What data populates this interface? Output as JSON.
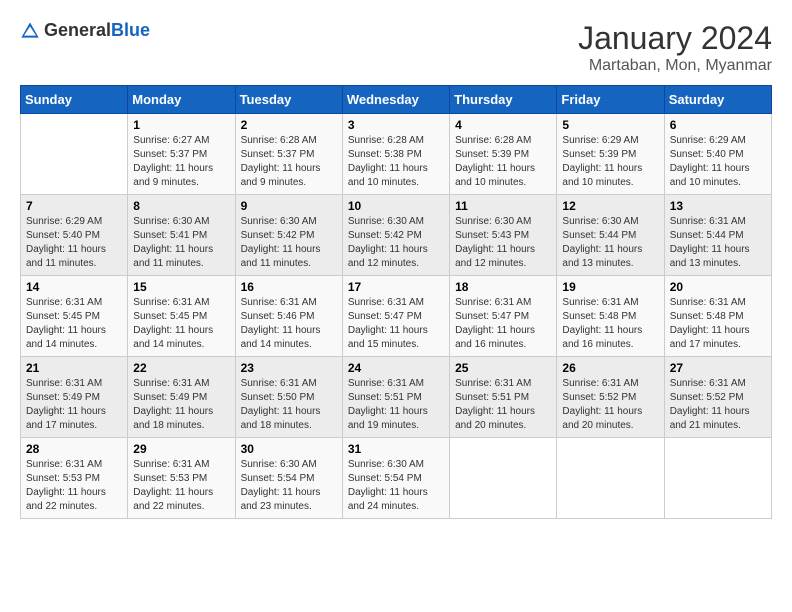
{
  "header": {
    "logo_general": "General",
    "logo_blue": "Blue",
    "title": "January 2024",
    "subtitle": "Martaban, Mon, Myanmar"
  },
  "weekdays": [
    "Sunday",
    "Monday",
    "Tuesday",
    "Wednesday",
    "Thursday",
    "Friday",
    "Saturday"
  ],
  "weeks": [
    [
      {
        "day": "",
        "info": ""
      },
      {
        "day": "1",
        "info": "Sunrise: 6:27 AM\nSunset: 5:37 PM\nDaylight: 11 hours\nand 9 minutes."
      },
      {
        "day": "2",
        "info": "Sunrise: 6:28 AM\nSunset: 5:37 PM\nDaylight: 11 hours\nand 9 minutes."
      },
      {
        "day": "3",
        "info": "Sunrise: 6:28 AM\nSunset: 5:38 PM\nDaylight: 11 hours\nand 10 minutes."
      },
      {
        "day": "4",
        "info": "Sunrise: 6:28 AM\nSunset: 5:39 PM\nDaylight: 11 hours\nand 10 minutes."
      },
      {
        "day": "5",
        "info": "Sunrise: 6:29 AM\nSunset: 5:39 PM\nDaylight: 11 hours\nand 10 minutes."
      },
      {
        "day": "6",
        "info": "Sunrise: 6:29 AM\nSunset: 5:40 PM\nDaylight: 11 hours\nand 10 minutes."
      }
    ],
    [
      {
        "day": "7",
        "info": "Sunrise: 6:29 AM\nSunset: 5:40 PM\nDaylight: 11 hours\nand 11 minutes."
      },
      {
        "day": "8",
        "info": "Sunrise: 6:30 AM\nSunset: 5:41 PM\nDaylight: 11 hours\nand 11 minutes."
      },
      {
        "day": "9",
        "info": "Sunrise: 6:30 AM\nSunset: 5:42 PM\nDaylight: 11 hours\nand 11 minutes."
      },
      {
        "day": "10",
        "info": "Sunrise: 6:30 AM\nSunset: 5:42 PM\nDaylight: 11 hours\nand 12 minutes."
      },
      {
        "day": "11",
        "info": "Sunrise: 6:30 AM\nSunset: 5:43 PM\nDaylight: 11 hours\nand 12 minutes."
      },
      {
        "day": "12",
        "info": "Sunrise: 6:30 AM\nSunset: 5:44 PM\nDaylight: 11 hours\nand 13 minutes."
      },
      {
        "day": "13",
        "info": "Sunrise: 6:31 AM\nSunset: 5:44 PM\nDaylight: 11 hours\nand 13 minutes."
      }
    ],
    [
      {
        "day": "14",
        "info": "Sunrise: 6:31 AM\nSunset: 5:45 PM\nDaylight: 11 hours\nand 14 minutes."
      },
      {
        "day": "15",
        "info": "Sunrise: 6:31 AM\nSunset: 5:45 PM\nDaylight: 11 hours\nand 14 minutes."
      },
      {
        "day": "16",
        "info": "Sunrise: 6:31 AM\nSunset: 5:46 PM\nDaylight: 11 hours\nand 14 minutes."
      },
      {
        "day": "17",
        "info": "Sunrise: 6:31 AM\nSunset: 5:47 PM\nDaylight: 11 hours\nand 15 minutes."
      },
      {
        "day": "18",
        "info": "Sunrise: 6:31 AM\nSunset: 5:47 PM\nDaylight: 11 hours\nand 16 minutes."
      },
      {
        "day": "19",
        "info": "Sunrise: 6:31 AM\nSunset: 5:48 PM\nDaylight: 11 hours\nand 16 minutes."
      },
      {
        "day": "20",
        "info": "Sunrise: 6:31 AM\nSunset: 5:48 PM\nDaylight: 11 hours\nand 17 minutes."
      }
    ],
    [
      {
        "day": "21",
        "info": "Sunrise: 6:31 AM\nSunset: 5:49 PM\nDaylight: 11 hours\nand 17 minutes."
      },
      {
        "day": "22",
        "info": "Sunrise: 6:31 AM\nSunset: 5:49 PM\nDaylight: 11 hours\nand 18 minutes."
      },
      {
        "day": "23",
        "info": "Sunrise: 6:31 AM\nSunset: 5:50 PM\nDaylight: 11 hours\nand 18 minutes."
      },
      {
        "day": "24",
        "info": "Sunrise: 6:31 AM\nSunset: 5:51 PM\nDaylight: 11 hours\nand 19 minutes."
      },
      {
        "day": "25",
        "info": "Sunrise: 6:31 AM\nSunset: 5:51 PM\nDaylight: 11 hours\nand 20 minutes."
      },
      {
        "day": "26",
        "info": "Sunrise: 6:31 AM\nSunset: 5:52 PM\nDaylight: 11 hours\nand 20 minutes."
      },
      {
        "day": "27",
        "info": "Sunrise: 6:31 AM\nSunset: 5:52 PM\nDaylight: 11 hours\nand 21 minutes."
      }
    ],
    [
      {
        "day": "28",
        "info": "Sunrise: 6:31 AM\nSunset: 5:53 PM\nDaylight: 11 hours\nand 22 minutes."
      },
      {
        "day": "29",
        "info": "Sunrise: 6:31 AM\nSunset: 5:53 PM\nDaylight: 11 hours\nand 22 minutes."
      },
      {
        "day": "30",
        "info": "Sunrise: 6:30 AM\nSunset: 5:54 PM\nDaylight: 11 hours\nand 23 minutes."
      },
      {
        "day": "31",
        "info": "Sunrise: 6:30 AM\nSunset: 5:54 PM\nDaylight: 11 hours\nand 24 minutes."
      },
      {
        "day": "",
        "info": ""
      },
      {
        "day": "",
        "info": ""
      },
      {
        "day": "",
        "info": ""
      }
    ]
  ]
}
